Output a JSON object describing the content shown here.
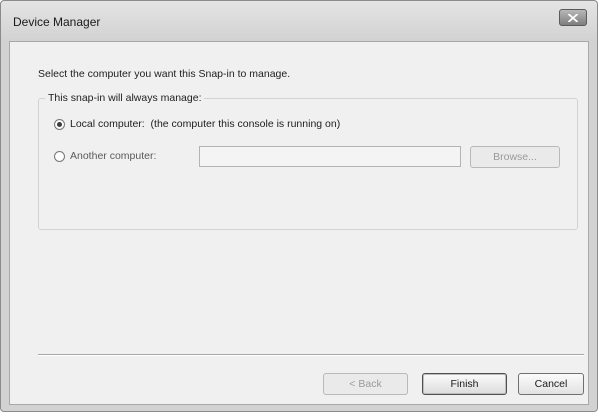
{
  "window": {
    "title": "Device Manager",
    "close_icon": "close-icon"
  },
  "dialog": {
    "instruction": "Select the computer you want this Snap-in to manage.",
    "group_label": "This snap-in will always manage:",
    "options": [
      {
        "label": "Local computer:  (the computer this console is running on)",
        "checked": true
      },
      {
        "label": "Another computer:",
        "checked": false
      }
    ],
    "computer_name": {
      "value": "",
      "placeholder": ""
    },
    "browse_label": "Browse..."
  },
  "footer": {
    "back_label": "< Back",
    "finish_label": "Finish",
    "cancel_label": "Cancel"
  },
  "colors": {
    "titlebar": "#d8d8d8",
    "client": "#f0f0f0",
    "close_button": "#8c8c8c"
  }
}
